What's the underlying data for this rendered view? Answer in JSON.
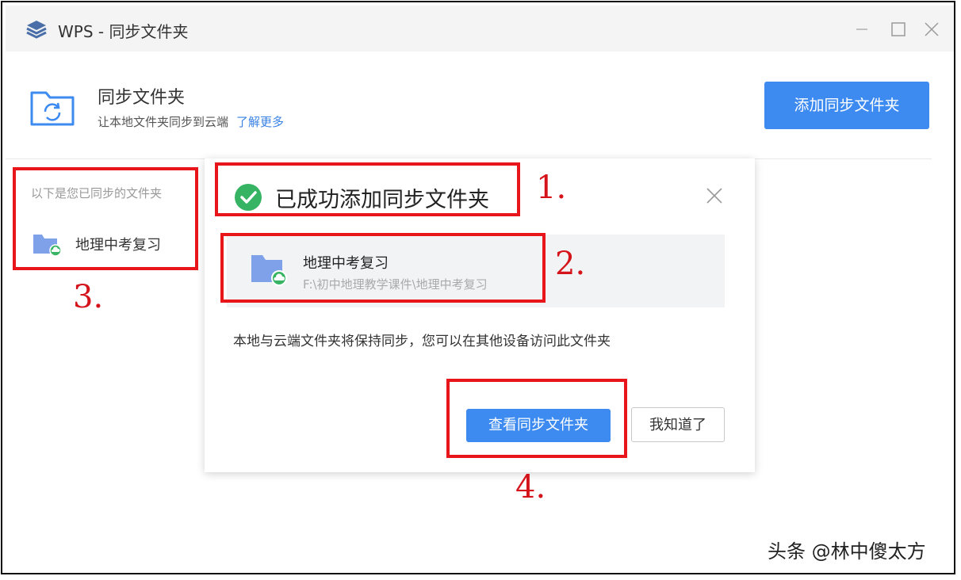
{
  "window": {
    "title": "WPS - 同步文件夹",
    "controls": {
      "minimize": "minimize-icon",
      "maximize": "maximize-icon",
      "close": "close-icon"
    }
  },
  "header": {
    "title": "同步文件夹",
    "subtitle": "让本地文件夹同步到云端",
    "learn_more": "了解更多",
    "add_button": "添加同步文件夹"
  },
  "list": {
    "label": "以下是您已同步的文件夹",
    "items": [
      {
        "name": "地理中考复习"
      }
    ],
    "background_fragment": "习"
  },
  "dialog": {
    "title": "已成功添加同步文件夹",
    "folder": {
      "name": "地理中考复习",
      "path": "F:\\初中地理教学课件\\地理中考复习"
    },
    "description": "本地与云端文件夹将保持同步，您可以在其他设备访问此文件夹",
    "view_button": "查看同步文件夹",
    "ok_button": "我知道了"
  },
  "annotations": [
    "1.",
    "2.",
    "3.",
    "4."
  ],
  "watermark": "头条 @林中傻太方",
  "colors": {
    "accent": "#3d8bf0",
    "annotation_red": "#e8151b",
    "success_green": "#36b463",
    "folder_blue": "#7ea1ea"
  }
}
